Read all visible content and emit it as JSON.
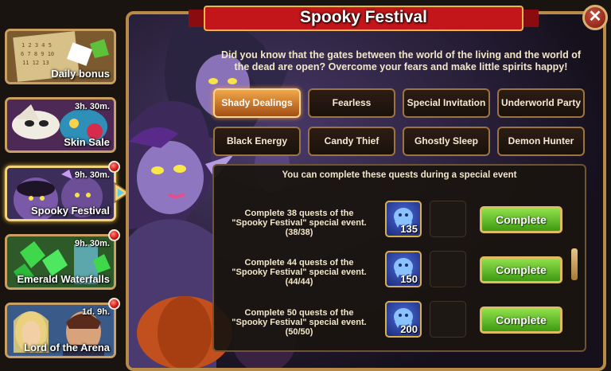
{
  "sidebar": {
    "items": [
      {
        "label": "Daily bonus",
        "timer": null
      },
      {
        "label": "Skin Sale",
        "timer": "3h. 30m."
      },
      {
        "label": "Spooky Festival",
        "timer": "9h. 30m."
      },
      {
        "label": "Emerald Waterfalls",
        "timer": "9h. 30m."
      },
      {
        "label": "Lord of the Arena",
        "timer": "1d. 9h."
      }
    ]
  },
  "window": {
    "title": "Spooky Festival",
    "close_icon": "✕",
    "description": "Did you know that the gates between the world of the living and the world of the dead are open? Overcome your fears and make little spirits happy!"
  },
  "tabs": [
    {
      "label": "Shady Dealings",
      "active": true
    },
    {
      "label": "Fearless",
      "active": false
    },
    {
      "label": "Special Invitation",
      "active": false
    },
    {
      "label": "Underworld Party",
      "active": false
    },
    {
      "label": "Black Energy",
      "active": false
    },
    {
      "label": "Candy Thief",
      "active": false
    },
    {
      "label": "Ghostly Sleep",
      "active": false
    },
    {
      "label": "Demon Hunter",
      "active": false
    }
  ],
  "quests": {
    "header": "You can complete these quests during a special event",
    "items": [
      {
        "text": "Complete 38 quests of the \"Spooky Festival\" special event.",
        "progress": "(38/38)",
        "reward_count": "135",
        "button": "Complete"
      },
      {
        "text": "Complete 44 quests of the \"Spooky Festival\" special event.",
        "progress": "(44/44)",
        "reward_count": "150",
        "button": "Complete"
      },
      {
        "text": "Complete 50 quests of the \"Spooky Festival\" special event.",
        "progress": "(50/50)",
        "reward_count": "200",
        "button": "Complete"
      }
    ]
  },
  "colors": {
    "accent_gold": "#c9a062",
    "complete_green": "#5bbd22",
    "active_tab": "#e3852e",
    "banner_red": "#c2161a"
  }
}
